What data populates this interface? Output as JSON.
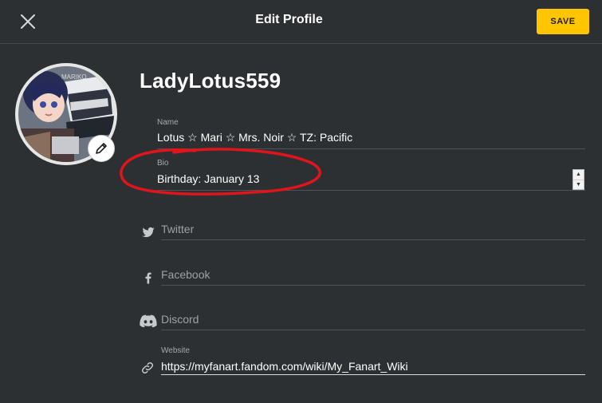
{
  "header": {
    "title": "Edit Profile",
    "save_label": "SAVE",
    "close_icon": "close-icon"
  },
  "profile": {
    "username": "LadyLotus559",
    "avatar_edit_icon": "pencil-icon"
  },
  "fields": {
    "name": {
      "label": "Name",
      "value": "Lotus ☆ Mari ☆ Mrs. Noir  ☆  TZ: Pacific"
    },
    "bio": {
      "label": "Bio",
      "value": "Birthday: January 13"
    },
    "twitter": {
      "placeholder": "Twitter",
      "icon": "twitter-icon"
    },
    "facebook": {
      "placeholder": "Facebook",
      "icon": "facebook-icon"
    },
    "discord": {
      "placeholder": "Discord",
      "icon": "discord-icon"
    },
    "website": {
      "label": "Website",
      "value": "https://myfanart.fandom.com/wiki/My_Fanart_Wiki",
      "icon": "link-icon"
    }
  },
  "colors": {
    "background": "#2c3032",
    "accent": "#ffc500",
    "annotation": "#e0141b"
  }
}
